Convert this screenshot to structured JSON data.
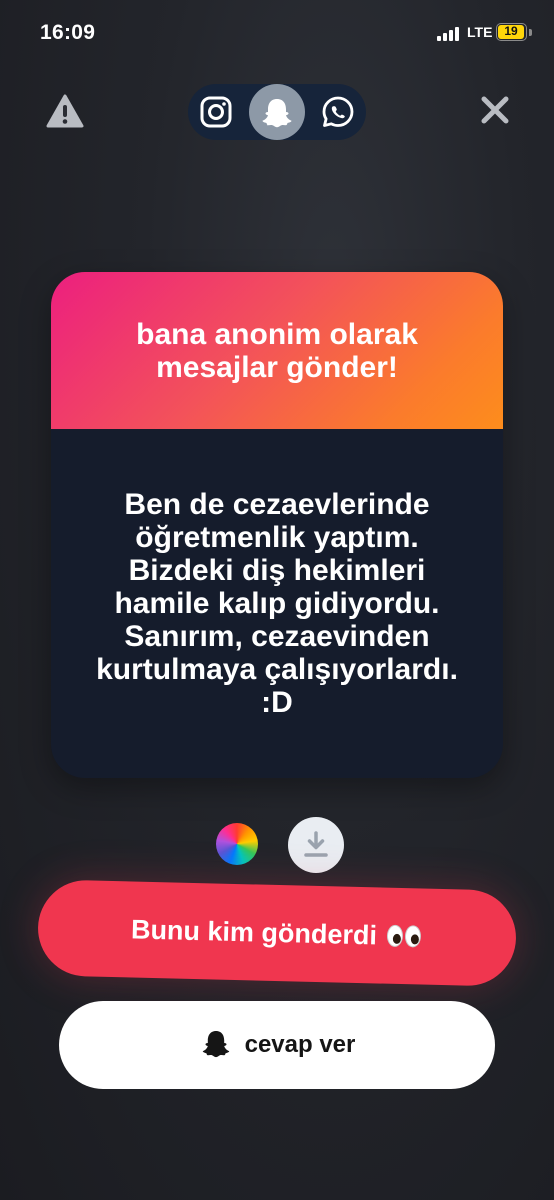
{
  "status_bar": {
    "time": "16:09",
    "network": "LTE",
    "battery": "19"
  },
  "top_bar": {
    "warning_icon": "warning-icon",
    "share_options": [
      "instagram-icon",
      "snapchat-icon",
      "whatsapp-icon"
    ],
    "selected_share": "snapchat",
    "close_icon": "close-icon"
  },
  "card": {
    "header": "bana anonim olarak mesajlar gönder!",
    "message": "Ben de cezaevlerinde öğretmenlik yaptım. Bizdeki diş hekimleri hamile kalıp gidiyordu. Sanırım, cezaevinden kurtulmaya çalışıyorlardı. :D"
  },
  "actions": {
    "who_sent_label": "Bunu kim gönderdi",
    "reply_label": "cevap ver"
  },
  "colors": {
    "accent_red": "#f0364f",
    "gradient_start": "#ec1f7f",
    "gradient_end": "#fd8d1c",
    "card_body": "#151c2c",
    "battery_yellow": "#ffd60a"
  }
}
